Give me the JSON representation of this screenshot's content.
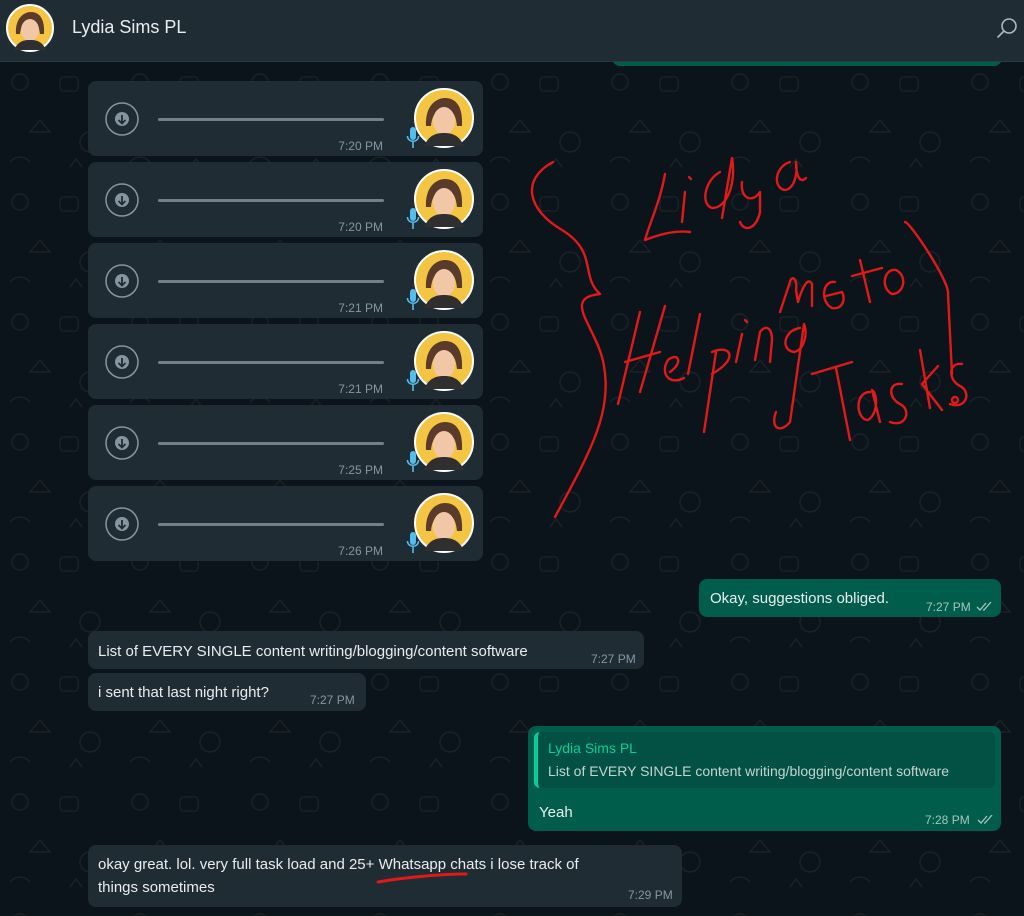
{
  "header": {
    "contact_name": "Lydia Sims PL",
    "search_icon": "search-icon"
  },
  "voice_messages": [
    {
      "time": "7:20 PM"
    },
    {
      "time": "7:20 PM"
    },
    {
      "time": "7:21 PM"
    },
    {
      "time": "7:21 PM"
    },
    {
      "time": "7:25 PM"
    },
    {
      "time": "7:26 PM"
    }
  ],
  "messages": {
    "m1": {
      "text": "Okay, suggestions obliged.",
      "time": "7:27 PM"
    },
    "m2": {
      "text": "List of EVERY SINGLE content writing/blogging/content software",
      "time": "7:27 PM"
    },
    "m3": {
      "text": "i sent that last night right?",
      "time": "7:27 PM"
    },
    "m4": {
      "quote_author": "Lydia Sims PL",
      "quote_text": "List of EVERY SINGLE content writing/blogging/content software",
      "text": "Yeah",
      "time": "7:28 PM"
    },
    "m5": {
      "line1": "okay great. lol. very full task load and 25+ Whatsapp chats i lose track of",
      "line2": "things sometimes",
      "time": "7:29 PM"
    }
  },
  "colors": {
    "header_bg": "#202c33",
    "chat_bg": "#0b141a",
    "incoming_bubble": "#202c33",
    "outgoing_bubble": "#005c4b",
    "accent": "#06cf9c",
    "annotation_red": "#e01919"
  }
}
